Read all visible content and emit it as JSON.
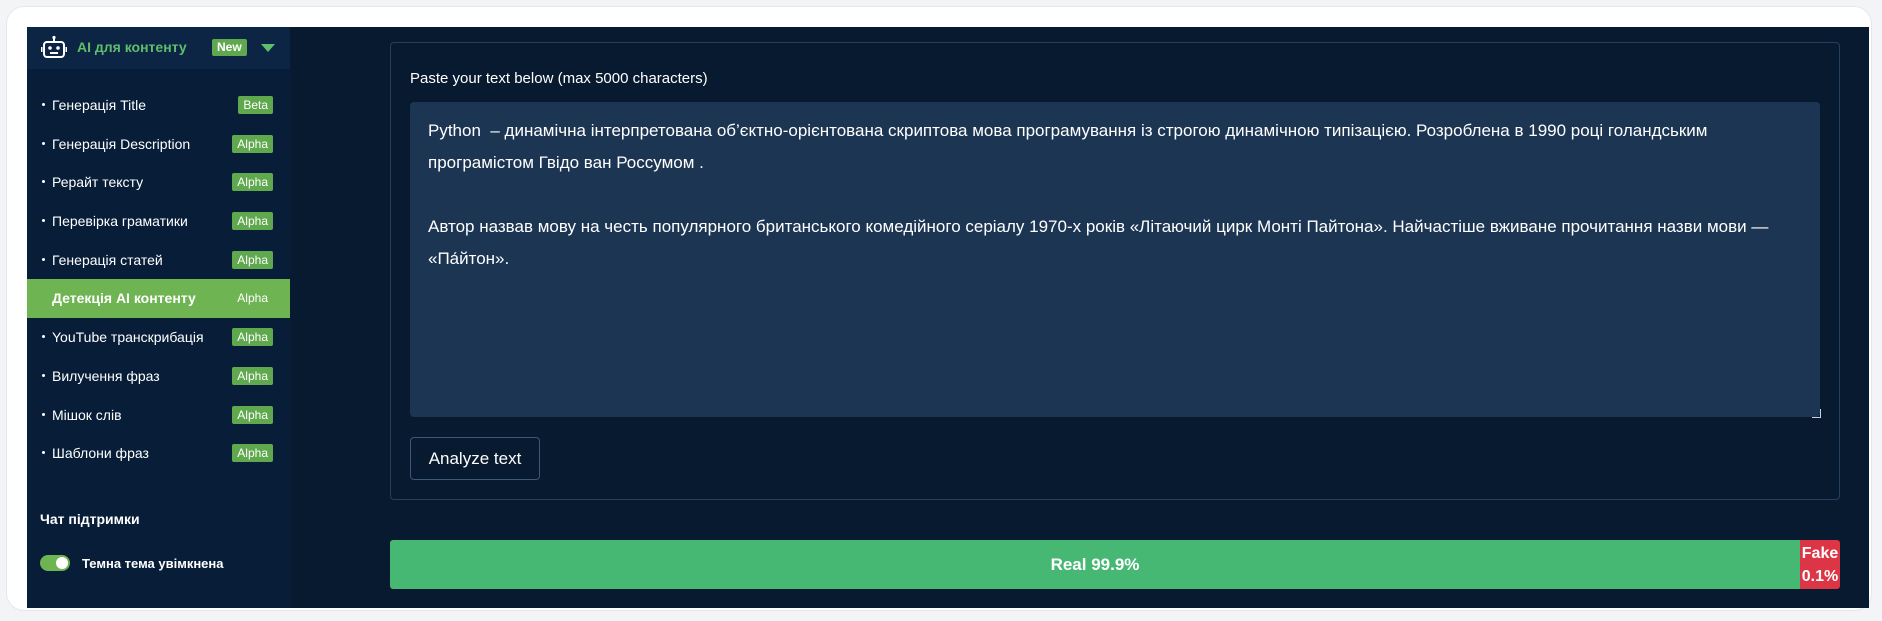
{
  "sidebar": {
    "header": {
      "label": "AI для контенту",
      "badge": "New"
    },
    "items": [
      {
        "label": "Генерація Title",
        "badge": "Beta",
        "active": false
      },
      {
        "label": "Генерація Description",
        "badge": "Alpha",
        "active": false
      },
      {
        "label": "Рерайт тексту",
        "badge": "Alpha",
        "active": false
      },
      {
        "label": "Перевірка граматики",
        "badge": "Alpha",
        "active": false
      },
      {
        "label": "Генерація статей",
        "badge": "Alpha",
        "active": false
      },
      {
        "label": "Детекція AI контенту",
        "badge": "Alpha",
        "active": true
      },
      {
        "label": "YouTube транскрибація",
        "badge": "Alpha",
        "active": false
      },
      {
        "label": "Вилучення фраз",
        "badge": "Alpha",
        "active": false
      },
      {
        "label": "Мішок слів",
        "badge": "Alpha",
        "active": false
      },
      {
        "label": "Шаблони фраз",
        "badge": "Alpha",
        "active": false
      }
    ],
    "support_title": "Чат підтримки",
    "theme_toggle": {
      "label": "Темна тема увімкнена",
      "on": true
    }
  },
  "main": {
    "input_label": "Paste your text below (max 5000 characters)",
    "text_value": "Python  – динамічна інтерпретована об’єктно-орієнтована скриптова мова програмування із строгою динамічною типізацією. Розроблена в 1990 році голандським програмістом Гвідо ван Россумом .\n\nАвтор назвав мову на честь популярного британського комедійного серіалу 1970-х років «Літаючий цирк Монті Пайтона». Найчастіше вживане прочитання назви мови — «Па́йтон».",
    "analyze_button": "Analyze text"
  },
  "result": {
    "real_label": "Real 99.9%",
    "real_fraction": 0.999,
    "fake_label_line1": "Fake",
    "fake_label_line2": "0.1%",
    "fake_fraction": 0.001
  },
  "colors": {
    "real": "#46b874",
    "fake": "#dc3545",
    "accent": "#6fb452",
    "background": "#071a30"
  }
}
